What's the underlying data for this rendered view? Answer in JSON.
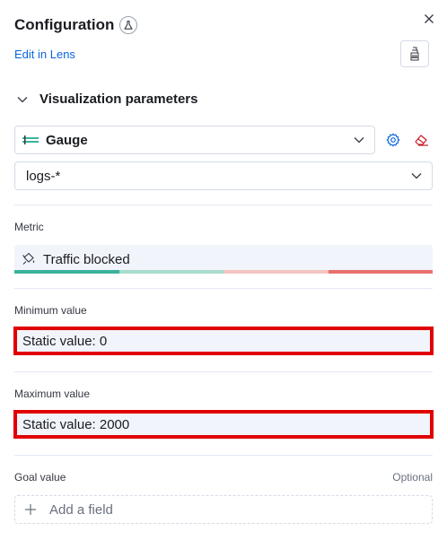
{
  "header": {
    "title": "Configuration",
    "edit_link": "Edit in Lens"
  },
  "section": {
    "title": "Visualization parameters"
  },
  "visualization": {
    "type_label": "Gauge",
    "index_pattern": "logs-*"
  },
  "metric": {
    "label": "Metric",
    "value": "Traffic blocked",
    "palette": [
      "#3ab39c",
      "#a8dccd",
      "#f4c4c0",
      "#e7706d"
    ]
  },
  "minimum": {
    "label": "Minimum value",
    "value": "Static value: 0"
  },
  "maximum": {
    "label": "Maximum value",
    "value": "Static value: 2000"
  },
  "goal": {
    "label": "Goal value",
    "optional": "Optional",
    "add_label": "Add a field"
  },
  "colors": {
    "link": "#0b64dd",
    "highlight": "#e00000",
    "danger_icon": "#c61e25",
    "accent_icon": "#0b64dd"
  }
}
